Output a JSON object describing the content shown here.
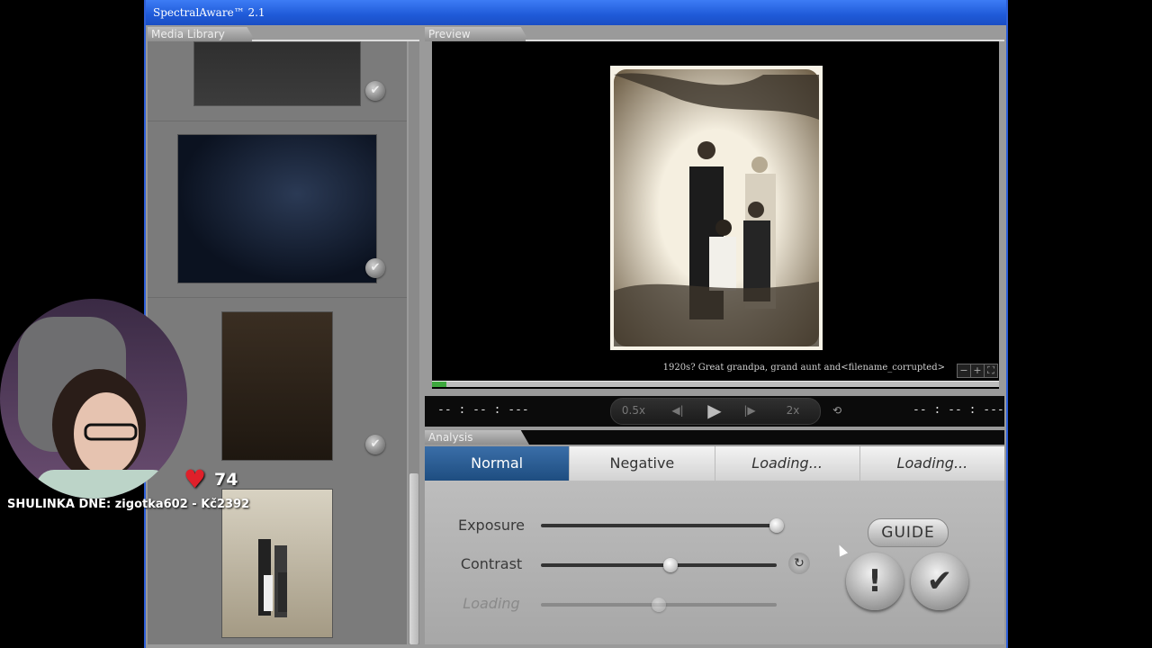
{
  "window": {
    "title": "SpectralAware™ 2.1"
  },
  "panels": {
    "library": "Media Library",
    "preview": "Preview",
    "analysis": "Analysis"
  },
  "preview": {
    "caption": "1920s? Great grandpa, grand aunt and<filename_corrupted>",
    "zoom_minus": "−",
    "zoom_plus": "+",
    "fullscreen": "⛶",
    "progress": 0.025
  },
  "transport": {
    "time_left": "-- : -- : ---",
    "time_right": "-- : -- : ---",
    "speed_slow": "0.5x",
    "speed_fast": "2x",
    "step_back": "◀|",
    "play": "▶",
    "step_fwd": "|▶",
    "loop": "⟲"
  },
  "analysis": {
    "modes": [
      "Normal",
      "Negative",
      "Loading...",
      "Loading..."
    ],
    "sliders": [
      {
        "label": "Exposure",
        "value": 1.0
      },
      {
        "label": "Contrast",
        "value": 0.55
      },
      {
        "label": "Loading",
        "value": 0.5
      }
    ],
    "reset_symbol": "↻",
    "guide": "GUIDE",
    "warn_symbol": "!",
    "ok_symbol": "✔"
  },
  "library": {
    "check_symbol": "✔"
  },
  "stream": {
    "heart_count": "74",
    "heart_symbol": "♥",
    "sponsor_text": "SHULINKA DNE: zigotka602 - Kč2392"
  }
}
